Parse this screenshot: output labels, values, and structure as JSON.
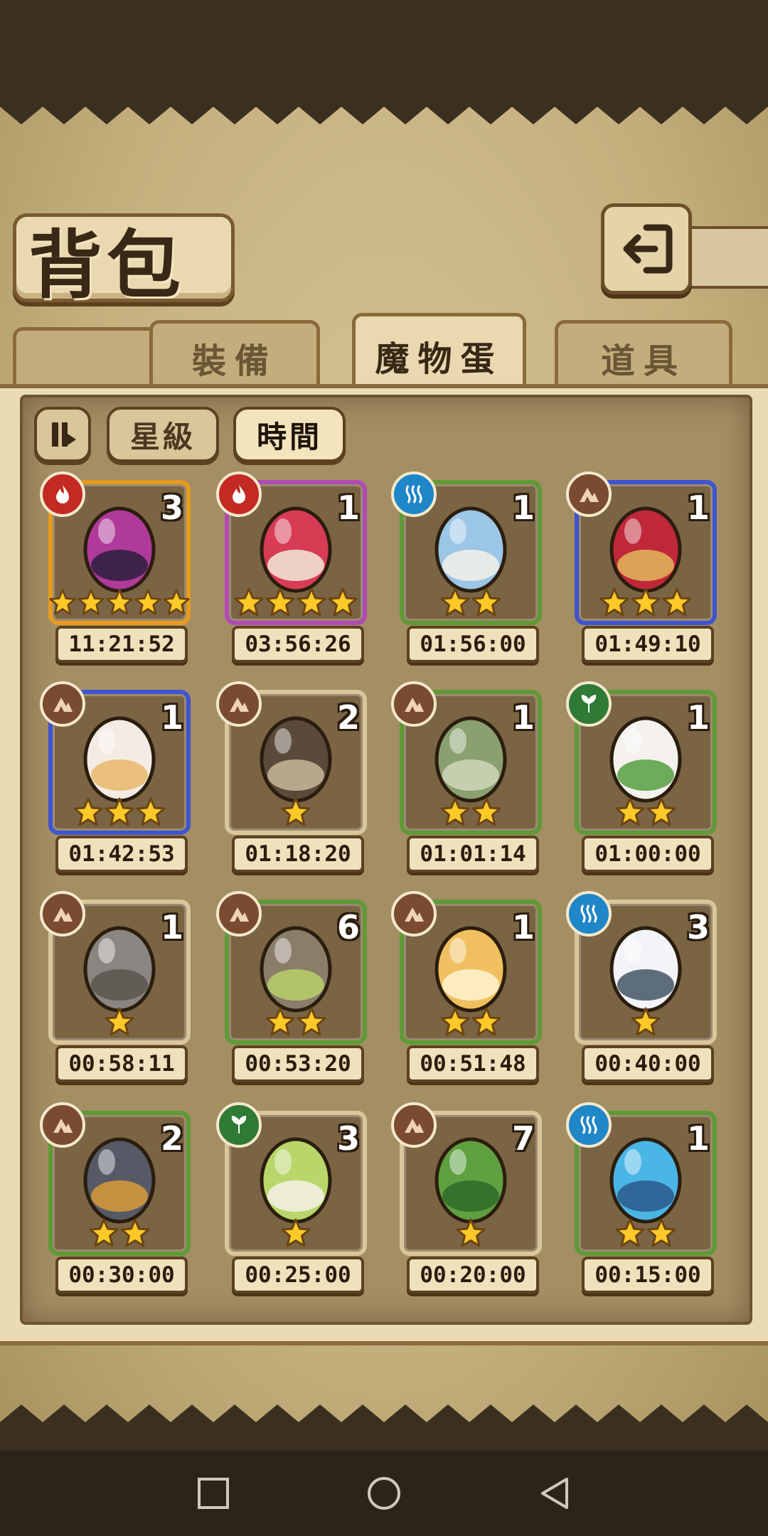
{
  "page": {
    "title": "背包",
    "colors": {
      "background_dark": "#3b3020",
      "parchment": "#d8c79a",
      "panel": "#a48e64",
      "frame_brown": "#6d4f28"
    }
  },
  "header": {
    "back_icon": "return-arrow-icon"
  },
  "tabs": [
    {
      "label": "裝備",
      "active": false
    },
    {
      "label": "魔物蛋",
      "active": true
    },
    {
      "label": "道具",
      "active": false
    }
  ],
  "sort": {
    "toggle_icon": "sort-order-icon",
    "buttons": [
      {
        "label": "星級",
        "active": false
      },
      {
        "label": "時間",
        "active": true
      }
    ]
  },
  "eggs": [
    {
      "element": "fire",
      "frame": "orange",
      "count": "3",
      "stars": 5,
      "time": "11:21:52",
      "art": "dark-orb-egg"
    },
    {
      "element": "fire",
      "frame": "purple",
      "count": "1",
      "stars": 4,
      "time": "03:56:26",
      "art": "kimono-egg"
    },
    {
      "element": "water",
      "frame": "green",
      "count": "1",
      "stars": 2,
      "time": "01:56:00",
      "art": "blue-bulb-egg"
    },
    {
      "element": "earth",
      "frame": "blue",
      "count": "1",
      "stars": 3,
      "time": "01:49:10",
      "art": "helmet-egg"
    },
    {
      "element": "earth",
      "frame": "blue",
      "count": "1",
      "stars": 3,
      "time": "01:42:53",
      "art": "fluffy-egg"
    },
    {
      "element": "earth",
      "frame": "tan",
      "count": "2",
      "stars": 1,
      "time": "01:18:20",
      "art": "armored-egg"
    },
    {
      "element": "earth",
      "frame": "green",
      "count": "1",
      "stars": 2,
      "time": "01:01:14",
      "art": "leaf-egg"
    },
    {
      "element": "wood",
      "frame": "green",
      "count": "1",
      "stars": 2,
      "time": "01:00:00",
      "art": "turnip-egg"
    },
    {
      "element": "earth",
      "frame": "tan",
      "count": "1",
      "stars": 1,
      "time": "00:58:11",
      "art": "rock-egg"
    },
    {
      "element": "earth",
      "frame": "green",
      "count": "6",
      "stars": 2,
      "time": "00:53:20",
      "art": "stone-egg"
    },
    {
      "element": "earth",
      "frame": "green",
      "count": "1",
      "stars": 2,
      "time": "00:51:48",
      "art": "golden-egg"
    },
    {
      "element": "water",
      "frame": "tan",
      "count": "3",
      "stars": 1,
      "time": "00:40:00",
      "art": "white-egg"
    },
    {
      "element": "earth",
      "frame": "green",
      "count": "2",
      "stars": 2,
      "time": "00:30:00",
      "art": "hat-egg"
    },
    {
      "element": "wood",
      "frame": "tan",
      "count": "3",
      "stars": 1,
      "time": "00:25:00",
      "art": "green-bulb-egg"
    },
    {
      "element": "earth",
      "frame": "tan",
      "count": "7",
      "stars": 1,
      "time": "00:20:00",
      "art": "sprout-egg"
    },
    {
      "element": "water",
      "frame": "green",
      "count": "1",
      "stars": 2,
      "time": "00:15:00",
      "art": "shell-egg"
    }
  ],
  "element_colors": {
    "fire": "#c22a23",
    "water": "#1f86c8",
    "earth": "#7a4b30",
    "wood": "#2f7a34"
  },
  "frame_colors": {
    "orange": "#e79b1e",
    "purple": "#b34ab5",
    "green": "#5f9a36",
    "blue": "#3e55cf",
    "tan": "#d9c69a"
  },
  "navbar": {
    "icons": [
      "recent-apps-icon",
      "home-icon",
      "back-icon"
    ]
  }
}
